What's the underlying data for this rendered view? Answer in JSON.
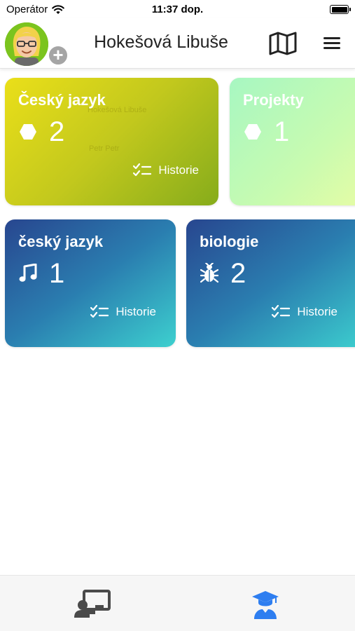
{
  "status_bar": {
    "carrier": "Operátor",
    "time": "11:37 dop."
  },
  "header": {
    "title": "Hokešová Libuše"
  },
  "ghost_names": [
    "Hokešová Libuše",
    "Petr Petr"
  ],
  "cards": [
    {
      "title": "Český jazyk",
      "icon": "hexagon-icon",
      "count": "2",
      "history_label": "Historie"
    },
    {
      "title": "Projekty",
      "icon": "hexagon-icon",
      "count": "1"
    },
    {
      "title": "český jazyk",
      "icon": "music-note-icon",
      "count": "1",
      "history_label": "Historie"
    },
    {
      "title": "biologie",
      "icon": "bug-icon",
      "count": "2",
      "history_label": "Historie"
    }
  ],
  "tab_bar": {
    "tabs": [
      {
        "icon": "teacher-board-icon",
        "active": false
      },
      {
        "icon": "graduate-student-icon",
        "active": true
      }
    ],
    "active_color": "#2e7ef0",
    "inactive_color": "#4a4a4a"
  }
}
